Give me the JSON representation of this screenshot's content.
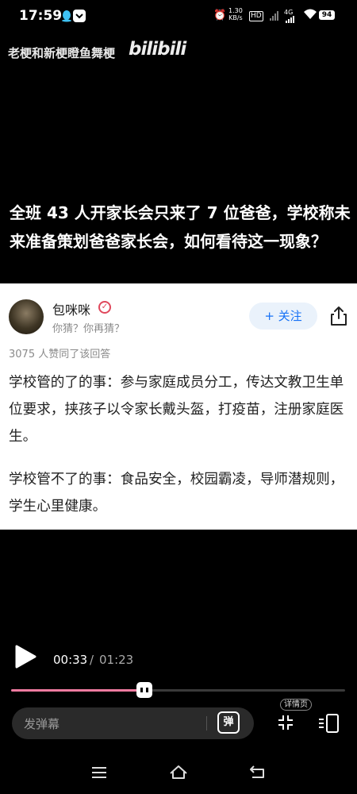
{
  "status_bar": {
    "time": "17:59",
    "net_speed_value": "1.30",
    "net_speed_unit": "KB/s",
    "hd_label": "HD",
    "lte_label": "4G",
    "battery": "94"
  },
  "video": {
    "title": "老梗和新梗瞪鱼舞梗",
    "logo_text": "bilibili"
  },
  "question": {
    "text": "全班 43 人开家长会只来了 7 位爸爸，学校称未来准备策划爸爸家长会，如何看待这一现象？"
  },
  "answer": {
    "author_name": "包咪咪",
    "author_bio": "你猜？你再猜？",
    "follow_label": "+ 关注",
    "likes_text": "3075 人赞同了该回答",
    "paragraphs": [
      "学校管的了的事：参与家庭成员分工，传达文教卫生单位要求，挟孩子以令家长戴头盔，打疫苗，注册家庭医生。",
      "学校管不了的事：食品安全，校园霸凌，导师潜规则，学生心里健康。"
    ]
  },
  "player": {
    "time_current": "00:33",
    "time_separator": "/",
    "time_total": "01:23",
    "progress_fraction": 0.398,
    "danmaku_placeholder": "发弹幕",
    "danmaku_toggle_label": "弹",
    "details_label": "详情页",
    "accent_color": "#f07ba0"
  },
  "icons": {
    "share": "share-icon",
    "play": "play-icon",
    "fullscreen": "fullscreen-icon",
    "layout": "layout-icon"
  }
}
